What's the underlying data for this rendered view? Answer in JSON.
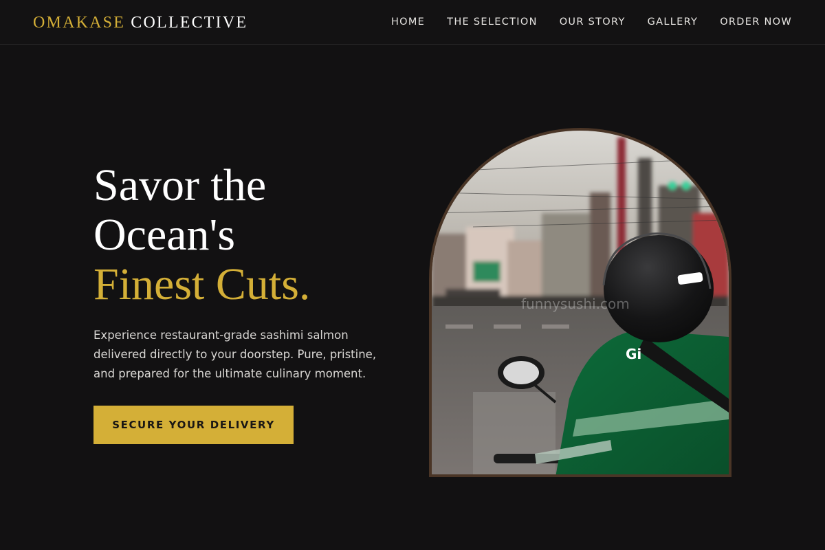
{
  "brand": {
    "part1": "OMAKASE",
    "part2": "COLLECTIVE"
  },
  "nav": [
    {
      "label": "HOME"
    },
    {
      "label": "THE SELECTION"
    },
    {
      "label": "OUR STORY"
    },
    {
      "label": "GALLERY"
    },
    {
      "label": "ORDER NOW"
    }
  ],
  "hero": {
    "title_line1": "Savor the",
    "title_line2": "Ocean's",
    "title_accent": "Finest Cuts.",
    "description": "Experience restaurant-grade sashimi salmon delivered directly to your doorstep. Pure, pristine, and prepared for the ultimate culinary moment.",
    "cta_label": "SECURE YOUR DELIVERY"
  },
  "image": {
    "watermark": "funnysushi.com",
    "jacket_text": "Gi"
  },
  "colors": {
    "accent": "#d4af37",
    "background": "#121112",
    "arch_border": "#4a3526"
  }
}
